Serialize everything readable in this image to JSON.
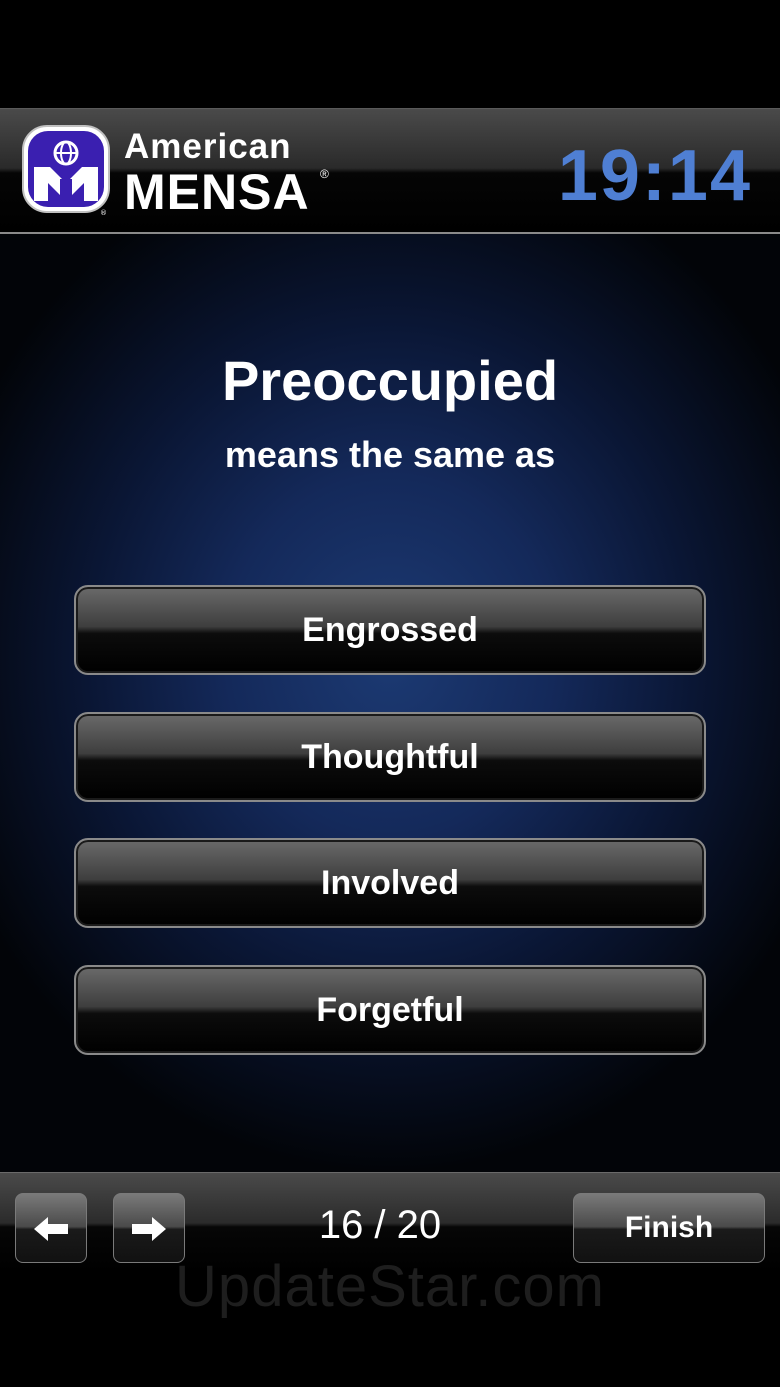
{
  "header": {
    "brand_line1": "American",
    "brand_line2": "MENSA",
    "registered_mark": "®",
    "timer": "19:14",
    "timer_color": "#4f7fd3",
    "logo_icon": "mensa-logo-icon"
  },
  "question": {
    "word": "Preoccupied",
    "prompt": "means the same as"
  },
  "answers": [
    {
      "label": "Engrossed"
    },
    {
      "label": "Thoughtful"
    },
    {
      "label": "Involved"
    },
    {
      "label": "Forgetful"
    }
  ],
  "toolbar": {
    "back_icon": "arrow-left-icon",
    "forward_icon": "arrow-right-icon",
    "back_glyph": "🡄",
    "forward_glyph": "🡆",
    "progress": "16 / 20",
    "finish_label": "Finish"
  },
  "watermark": "UpdateStar.com"
}
